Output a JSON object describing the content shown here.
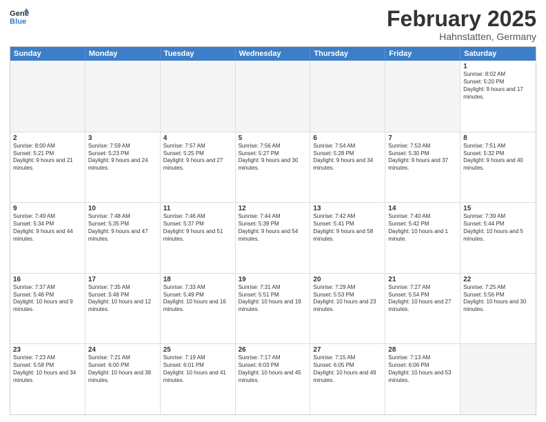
{
  "header": {
    "logo_general": "General",
    "logo_blue": "Blue",
    "month_year": "February 2025",
    "location": "Hahnstatten, Germany"
  },
  "calendar": {
    "days_of_week": [
      "Sunday",
      "Monday",
      "Tuesday",
      "Wednesday",
      "Thursday",
      "Friday",
      "Saturday"
    ],
    "rows": [
      [
        {
          "day": "",
          "text": "",
          "empty": true
        },
        {
          "day": "",
          "text": "",
          "empty": true
        },
        {
          "day": "",
          "text": "",
          "empty": true
        },
        {
          "day": "",
          "text": "",
          "empty": true
        },
        {
          "day": "",
          "text": "",
          "empty": true
        },
        {
          "day": "",
          "text": "",
          "empty": true
        },
        {
          "day": "1",
          "text": "Sunrise: 8:02 AM\nSunset: 5:20 PM\nDaylight: 9 hours and 17 minutes.",
          "empty": false
        }
      ],
      [
        {
          "day": "2",
          "text": "Sunrise: 8:00 AM\nSunset: 5:21 PM\nDaylight: 9 hours and 21 minutes.",
          "empty": false
        },
        {
          "day": "3",
          "text": "Sunrise: 7:59 AM\nSunset: 5:23 PM\nDaylight: 9 hours and 24 minutes.",
          "empty": false
        },
        {
          "day": "4",
          "text": "Sunrise: 7:57 AM\nSunset: 5:25 PM\nDaylight: 9 hours and 27 minutes.",
          "empty": false
        },
        {
          "day": "5",
          "text": "Sunrise: 7:56 AM\nSunset: 5:27 PM\nDaylight: 9 hours and 30 minutes.",
          "empty": false
        },
        {
          "day": "6",
          "text": "Sunrise: 7:54 AM\nSunset: 5:28 PM\nDaylight: 9 hours and 34 minutes.",
          "empty": false
        },
        {
          "day": "7",
          "text": "Sunrise: 7:53 AM\nSunset: 5:30 PM\nDaylight: 9 hours and 37 minutes.",
          "empty": false
        },
        {
          "day": "8",
          "text": "Sunrise: 7:51 AM\nSunset: 5:32 PM\nDaylight: 9 hours and 40 minutes.",
          "empty": false
        }
      ],
      [
        {
          "day": "9",
          "text": "Sunrise: 7:49 AM\nSunset: 5:34 PM\nDaylight: 9 hours and 44 minutes.",
          "empty": false
        },
        {
          "day": "10",
          "text": "Sunrise: 7:48 AM\nSunset: 5:35 PM\nDaylight: 9 hours and 47 minutes.",
          "empty": false
        },
        {
          "day": "11",
          "text": "Sunrise: 7:46 AM\nSunset: 5:37 PM\nDaylight: 9 hours and 51 minutes.",
          "empty": false
        },
        {
          "day": "12",
          "text": "Sunrise: 7:44 AM\nSunset: 5:39 PM\nDaylight: 9 hours and 54 minutes.",
          "empty": false
        },
        {
          "day": "13",
          "text": "Sunrise: 7:42 AM\nSunset: 5:41 PM\nDaylight: 9 hours and 58 minutes.",
          "empty": false
        },
        {
          "day": "14",
          "text": "Sunrise: 7:40 AM\nSunset: 5:42 PM\nDaylight: 10 hours and 1 minute.",
          "empty": false
        },
        {
          "day": "15",
          "text": "Sunrise: 7:39 AM\nSunset: 5:44 PM\nDaylight: 10 hours and 5 minutes.",
          "empty": false
        }
      ],
      [
        {
          "day": "16",
          "text": "Sunrise: 7:37 AM\nSunset: 5:46 PM\nDaylight: 10 hours and 9 minutes.",
          "empty": false
        },
        {
          "day": "17",
          "text": "Sunrise: 7:35 AM\nSunset: 5:48 PM\nDaylight: 10 hours and 12 minutes.",
          "empty": false
        },
        {
          "day": "18",
          "text": "Sunrise: 7:33 AM\nSunset: 5:49 PM\nDaylight: 10 hours and 16 minutes.",
          "empty": false
        },
        {
          "day": "19",
          "text": "Sunrise: 7:31 AM\nSunset: 5:51 PM\nDaylight: 10 hours and 19 minutes.",
          "empty": false
        },
        {
          "day": "20",
          "text": "Sunrise: 7:29 AM\nSunset: 5:53 PM\nDaylight: 10 hours and 23 minutes.",
          "empty": false
        },
        {
          "day": "21",
          "text": "Sunrise: 7:27 AM\nSunset: 5:54 PM\nDaylight: 10 hours and 27 minutes.",
          "empty": false
        },
        {
          "day": "22",
          "text": "Sunrise: 7:25 AM\nSunset: 5:56 PM\nDaylight: 10 hours and 30 minutes.",
          "empty": false
        }
      ],
      [
        {
          "day": "23",
          "text": "Sunrise: 7:23 AM\nSunset: 5:58 PM\nDaylight: 10 hours and 34 minutes.",
          "empty": false
        },
        {
          "day": "24",
          "text": "Sunrise: 7:21 AM\nSunset: 6:00 PM\nDaylight: 10 hours and 38 minutes.",
          "empty": false
        },
        {
          "day": "25",
          "text": "Sunrise: 7:19 AM\nSunset: 6:01 PM\nDaylight: 10 hours and 41 minutes.",
          "empty": false
        },
        {
          "day": "26",
          "text": "Sunrise: 7:17 AM\nSunset: 6:03 PM\nDaylight: 10 hours and 45 minutes.",
          "empty": false
        },
        {
          "day": "27",
          "text": "Sunrise: 7:15 AM\nSunset: 6:05 PM\nDaylight: 10 hours and 49 minutes.",
          "empty": false
        },
        {
          "day": "28",
          "text": "Sunrise: 7:13 AM\nSunset: 6:06 PM\nDaylight: 10 hours and 53 minutes.",
          "empty": false
        },
        {
          "day": "",
          "text": "",
          "empty": true
        }
      ]
    ]
  }
}
